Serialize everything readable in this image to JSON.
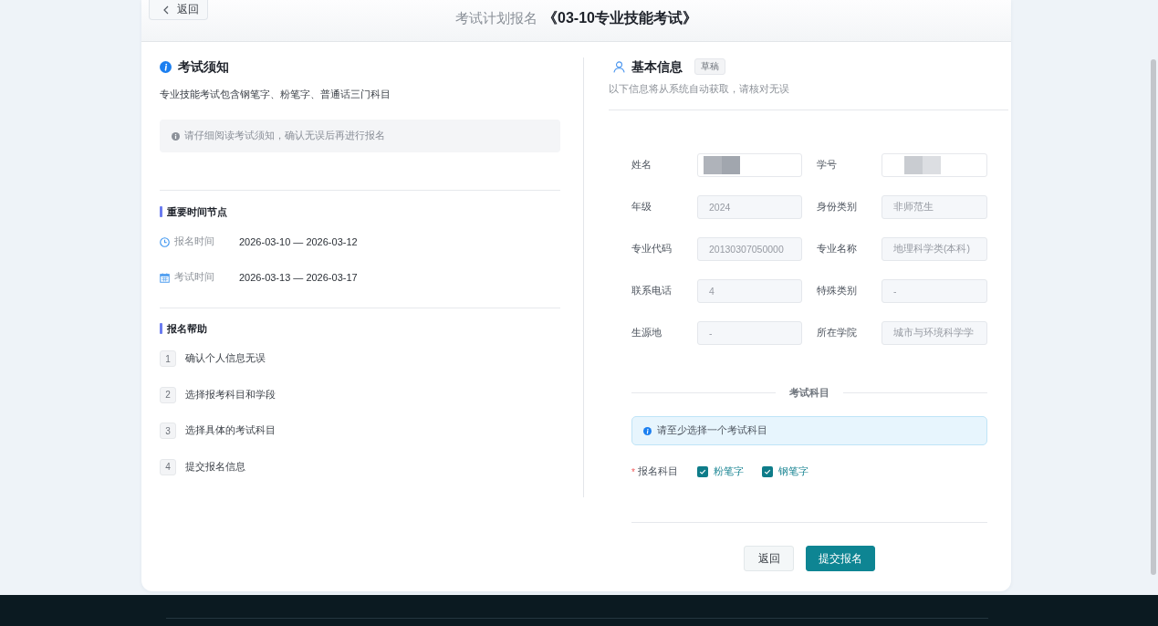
{
  "header": {
    "back_button": "返回",
    "title_prefix": "考试计划报名",
    "title": "《03-10专业技能考试》"
  },
  "notice": {
    "title": "考试须知",
    "description": "专业技能考试包含钢笔字、粉笔字、普通话三门科目",
    "tip": "请仔细阅读考试须知，确认无误后再进行报名"
  },
  "timeline": {
    "title": "重要时间节点",
    "items": [
      {
        "kind": "clock",
        "label": "报名时间",
        "value": "2026-03-10 — 2026-03-12"
      },
      {
        "kind": "calendar",
        "label": "考试时间",
        "value": "2026-03-13 — 2026-03-17"
      }
    ]
  },
  "help": {
    "title": "报名帮助",
    "steps": [
      {
        "number": "1",
        "text": "确认个人信息无误"
      },
      {
        "number": "2",
        "text": "选择报考科目和学段"
      },
      {
        "number": "3",
        "text": "选择具体的考试科目"
      },
      {
        "number": "4",
        "text": "提交报名信息"
      }
    ]
  },
  "basic_info": {
    "title": "基本信息",
    "tag": "草稿",
    "subtitle": "以下信息将从系统自动获取，请核对无误",
    "fields": [
      {
        "label": "姓名",
        "kind": "redacted"
      },
      {
        "label": "学号",
        "kind": "redacted"
      },
      {
        "label": "年级",
        "kind": "text",
        "value": "2024",
        "disabled": true
      },
      {
        "label": "身份类别",
        "kind": "text",
        "value": "非师范生",
        "disabled": true
      },
      {
        "label": "专业代码",
        "kind": "text",
        "value": "20130307050000",
        "disabled": true
      },
      {
        "label": "专业名称",
        "kind": "text",
        "value": "地理科学类(本科)",
        "disabled": true
      },
      {
        "label": "联系电话",
        "kind": "text",
        "value": "4",
        "disabled": true
      },
      {
        "label": "特殊类别",
        "kind": "text",
        "value": "-",
        "disabled": true
      },
      {
        "label": "生源地",
        "kind": "text",
        "value": "-",
        "disabled": true
      },
      {
        "label": "所在学院",
        "kind": "text",
        "value": "城市与环境科学学",
        "disabled": true
      }
    ]
  },
  "subjects": {
    "divider_title": "考试科目",
    "alert": "请至少选择一个考试科目",
    "required_mark": "*",
    "label": "报名科目",
    "options": [
      {
        "label": "粉笔字",
        "checked": true
      },
      {
        "label": "钢笔字",
        "checked": true
      }
    ]
  },
  "actions": [
    {
      "label": "返回",
      "kind": "secondary"
    },
    {
      "label": "提交报名",
      "kind": "primary"
    }
  ]
}
